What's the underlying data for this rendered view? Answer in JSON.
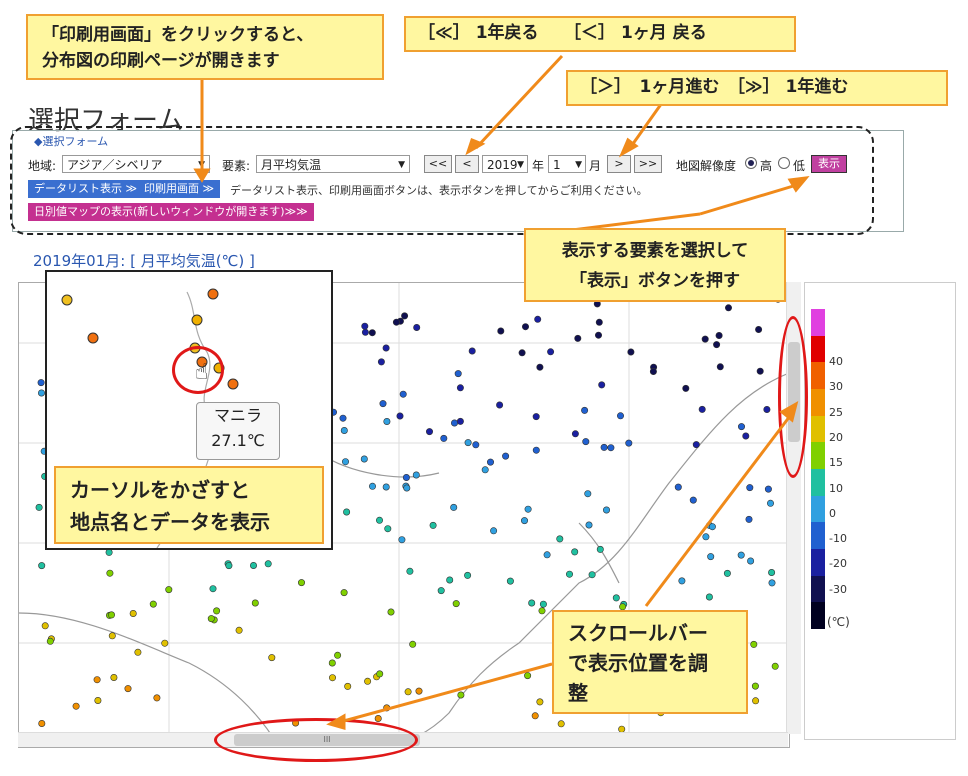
{
  "callouts": {
    "print": "「印刷用画面」をクリックすると、\n分布図の印刷ページが開きます",
    "back": "［≪］ 1年戻る　　［＜］ 1ヶ月 戻る",
    "fwd": "［＞］　1ヶ月進む　［≫］ 1年進む",
    "show": "表示する要素を選択して\n「表示」ボタンを押す",
    "hover": "カーソルをかざすと\n地点名とデータを表示",
    "scroll": "スクロールバー\nで表示位置を調\n整"
  },
  "page_title": "選択フォーム",
  "form": {
    "legend": "◆選択フォーム",
    "region_label": "地域:",
    "region_value": "アジア／シベリア",
    "element_label": "要素:",
    "element_value": "月平均気温",
    "btn_prev_year": "<<",
    "btn_prev_month": "<",
    "year_value": "2019",
    "year_unit": "年",
    "month_value": "1",
    "month_unit": "月",
    "btn_next_month": ">",
    "btn_next_year": ">>",
    "resolution_label": "地図解像度",
    "res_high": "高",
    "res_low": "低",
    "show_button": "表示",
    "data_list_button": "データリスト表示 ≫",
    "print_button": "印刷用画面 ≫",
    "note": "データリスト表示、印刷用画面ボタンは、表示ボタンを押してからご利用ください。",
    "daily_map_button": "日別値マップの表示(新しいウィンドウが開きます)≫≫"
  },
  "map_heading": "2019年01月: [ 月平均気温(℃) ]",
  "tooltip": {
    "station": "マニラ",
    "value": "27.1℃"
  },
  "colorbar": {
    "ticks": [
      "40",
      "30",
      "25",
      "20",
      "15",
      "10",
      "0",
      "-10",
      "-20",
      "-30"
    ],
    "unit": "(℃)",
    "colors": [
      "#e040e0",
      "#e00000",
      "#f06000",
      "#f09000",
      "#e0c000",
      "#80d000",
      "#20c0a0",
      "#30a0e0",
      "#2060d0",
      "#1a20a0",
      "#101050",
      "#000020"
    ]
  },
  "scroll_handle_glyph": "III"
}
